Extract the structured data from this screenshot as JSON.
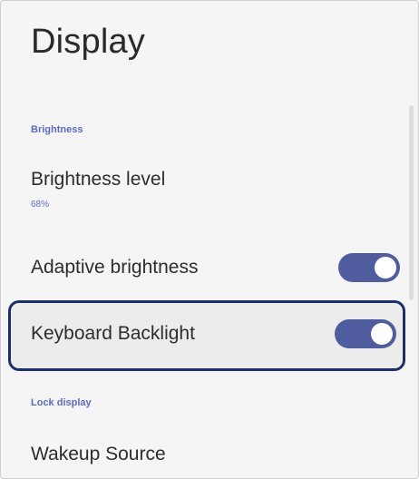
{
  "page": {
    "title": "Display"
  },
  "sections": {
    "brightness": {
      "header": "Brightness"
    },
    "lock_display": {
      "header": "Lock display"
    }
  },
  "rows": {
    "brightness_level": {
      "title": "Brightness level",
      "value": "68%"
    },
    "adaptive_brightness": {
      "title": "Adaptive brightness",
      "toggle_on": true
    },
    "keyboard_backlight": {
      "title": "Keyboard Backlight",
      "toggle_on": true
    },
    "wakeup_source": {
      "title": "Wakeup Source"
    }
  },
  "colors": {
    "accent": "#5c6bc0",
    "toggle_track": "#4f5d9e",
    "highlight_border": "#1c2f6b"
  }
}
